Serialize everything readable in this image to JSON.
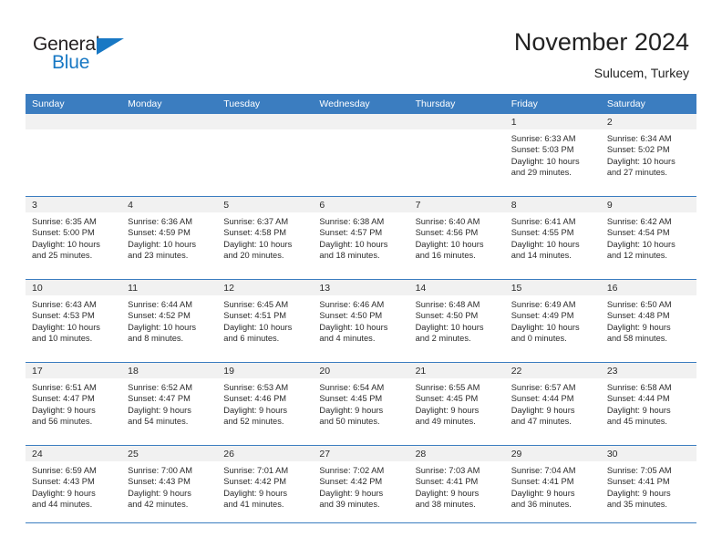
{
  "brand": {
    "word_one": "General",
    "word_two": "Blue",
    "triangle_color": "#1878c4"
  },
  "header": {
    "title": "November 2024",
    "subtitle": "Sulucem, Turkey"
  },
  "theme": {
    "header_bar": "#3b7dc0",
    "day_band": "#f1f1f1",
    "text": "#2b2b2b",
    "accent": "#1878c4"
  },
  "weekday_headers": [
    "Sunday",
    "Monday",
    "Tuesday",
    "Wednesday",
    "Thursday",
    "Friday",
    "Saturday"
  ],
  "weeks": [
    [
      {
        "day": "",
        "empty": true,
        "sunrise": "",
        "sunset": "",
        "daylight_line1": "",
        "daylight_line2": ""
      },
      {
        "day": "",
        "empty": true,
        "sunrise": "",
        "sunset": "",
        "daylight_line1": "",
        "daylight_line2": ""
      },
      {
        "day": "",
        "empty": true,
        "sunrise": "",
        "sunset": "",
        "daylight_line1": "",
        "daylight_line2": ""
      },
      {
        "day": "",
        "empty": true,
        "sunrise": "",
        "sunset": "",
        "daylight_line1": "",
        "daylight_line2": ""
      },
      {
        "day": "",
        "empty": true,
        "sunrise": "",
        "sunset": "",
        "daylight_line1": "",
        "daylight_line2": ""
      },
      {
        "day": "1",
        "sunrise": "Sunrise: 6:33 AM",
        "sunset": "Sunset: 5:03 PM",
        "daylight_line1": "Daylight: 10 hours",
        "daylight_line2": "and 29 minutes."
      },
      {
        "day": "2",
        "sunrise": "Sunrise: 6:34 AM",
        "sunset": "Sunset: 5:02 PM",
        "daylight_line1": "Daylight: 10 hours",
        "daylight_line2": "and 27 minutes."
      }
    ],
    [
      {
        "day": "3",
        "sunrise": "Sunrise: 6:35 AM",
        "sunset": "Sunset: 5:00 PM",
        "daylight_line1": "Daylight: 10 hours",
        "daylight_line2": "and 25 minutes."
      },
      {
        "day": "4",
        "sunrise": "Sunrise: 6:36 AM",
        "sunset": "Sunset: 4:59 PM",
        "daylight_line1": "Daylight: 10 hours",
        "daylight_line2": "and 23 minutes."
      },
      {
        "day": "5",
        "sunrise": "Sunrise: 6:37 AM",
        "sunset": "Sunset: 4:58 PM",
        "daylight_line1": "Daylight: 10 hours",
        "daylight_line2": "and 20 minutes."
      },
      {
        "day": "6",
        "sunrise": "Sunrise: 6:38 AM",
        "sunset": "Sunset: 4:57 PM",
        "daylight_line1": "Daylight: 10 hours",
        "daylight_line2": "and 18 minutes."
      },
      {
        "day": "7",
        "sunrise": "Sunrise: 6:40 AM",
        "sunset": "Sunset: 4:56 PM",
        "daylight_line1": "Daylight: 10 hours",
        "daylight_line2": "and 16 minutes."
      },
      {
        "day": "8",
        "sunrise": "Sunrise: 6:41 AM",
        "sunset": "Sunset: 4:55 PM",
        "daylight_line1": "Daylight: 10 hours",
        "daylight_line2": "and 14 minutes."
      },
      {
        "day": "9",
        "sunrise": "Sunrise: 6:42 AM",
        "sunset": "Sunset: 4:54 PM",
        "daylight_line1": "Daylight: 10 hours",
        "daylight_line2": "and 12 minutes."
      }
    ],
    [
      {
        "day": "10",
        "sunrise": "Sunrise: 6:43 AM",
        "sunset": "Sunset: 4:53 PM",
        "daylight_line1": "Daylight: 10 hours",
        "daylight_line2": "and 10 minutes."
      },
      {
        "day": "11",
        "sunrise": "Sunrise: 6:44 AM",
        "sunset": "Sunset: 4:52 PM",
        "daylight_line1": "Daylight: 10 hours",
        "daylight_line2": "and 8 minutes."
      },
      {
        "day": "12",
        "sunrise": "Sunrise: 6:45 AM",
        "sunset": "Sunset: 4:51 PM",
        "daylight_line1": "Daylight: 10 hours",
        "daylight_line2": "and 6 minutes."
      },
      {
        "day": "13",
        "sunrise": "Sunrise: 6:46 AM",
        "sunset": "Sunset: 4:50 PM",
        "daylight_line1": "Daylight: 10 hours",
        "daylight_line2": "and 4 minutes."
      },
      {
        "day": "14",
        "sunrise": "Sunrise: 6:48 AM",
        "sunset": "Sunset: 4:50 PM",
        "daylight_line1": "Daylight: 10 hours",
        "daylight_line2": "and 2 minutes."
      },
      {
        "day": "15",
        "sunrise": "Sunrise: 6:49 AM",
        "sunset": "Sunset: 4:49 PM",
        "daylight_line1": "Daylight: 10 hours",
        "daylight_line2": "and 0 minutes."
      },
      {
        "day": "16",
        "sunrise": "Sunrise: 6:50 AM",
        "sunset": "Sunset: 4:48 PM",
        "daylight_line1": "Daylight: 9 hours",
        "daylight_line2": "and 58 minutes."
      }
    ],
    [
      {
        "day": "17",
        "sunrise": "Sunrise: 6:51 AM",
        "sunset": "Sunset: 4:47 PM",
        "daylight_line1": "Daylight: 9 hours",
        "daylight_line2": "and 56 minutes."
      },
      {
        "day": "18",
        "sunrise": "Sunrise: 6:52 AM",
        "sunset": "Sunset: 4:47 PM",
        "daylight_line1": "Daylight: 9 hours",
        "daylight_line2": "and 54 minutes."
      },
      {
        "day": "19",
        "sunrise": "Sunrise: 6:53 AM",
        "sunset": "Sunset: 4:46 PM",
        "daylight_line1": "Daylight: 9 hours",
        "daylight_line2": "and 52 minutes."
      },
      {
        "day": "20",
        "sunrise": "Sunrise: 6:54 AM",
        "sunset": "Sunset: 4:45 PM",
        "daylight_line1": "Daylight: 9 hours",
        "daylight_line2": "and 50 minutes."
      },
      {
        "day": "21",
        "sunrise": "Sunrise: 6:55 AM",
        "sunset": "Sunset: 4:45 PM",
        "daylight_line1": "Daylight: 9 hours",
        "daylight_line2": "and 49 minutes."
      },
      {
        "day": "22",
        "sunrise": "Sunrise: 6:57 AM",
        "sunset": "Sunset: 4:44 PM",
        "daylight_line1": "Daylight: 9 hours",
        "daylight_line2": "and 47 minutes."
      },
      {
        "day": "23",
        "sunrise": "Sunrise: 6:58 AM",
        "sunset": "Sunset: 4:44 PM",
        "daylight_line1": "Daylight: 9 hours",
        "daylight_line2": "and 45 minutes."
      }
    ],
    [
      {
        "day": "24",
        "sunrise": "Sunrise: 6:59 AM",
        "sunset": "Sunset: 4:43 PM",
        "daylight_line1": "Daylight: 9 hours",
        "daylight_line2": "and 44 minutes."
      },
      {
        "day": "25",
        "sunrise": "Sunrise: 7:00 AM",
        "sunset": "Sunset: 4:43 PM",
        "daylight_line1": "Daylight: 9 hours",
        "daylight_line2": "and 42 minutes."
      },
      {
        "day": "26",
        "sunrise": "Sunrise: 7:01 AM",
        "sunset": "Sunset: 4:42 PM",
        "daylight_line1": "Daylight: 9 hours",
        "daylight_line2": "and 41 minutes."
      },
      {
        "day": "27",
        "sunrise": "Sunrise: 7:02 AM",
        "sunset": "Sunset: 4:42 PM",
        "daylight_line1": "Daylight: 9 hours",
        "daylight_line2": "and 39 minutes."
      },
      {
        "day": "28",
        "sunrise": "Sunrise: 7:03 AM",
        "sunset": "Sunset: 4:41 PM",
        "daylight_line1": "Daylight: 9 hours",
        "daylight_line2": "and 38 minutes."
      },
      {
        "day": "29",
        "sunrise": "Sunrise: 7:04 AM",
        "sunset": "Sunset: 4:41 PM",
        "daylight_line1": "Daylight: 9 hours",
        "daylight_line2": "and 36 minutes."
      },
      {
        "day": "30",
        "sunrise": "Sunrise: 7:05 AM",
        "sunset": "Sunset: 4:41 PM",
        "daylight_line1": "Daylight: 9 hours",
        "daylight_line2": "and 35 minutes."
      }
    ]
  ]
}
